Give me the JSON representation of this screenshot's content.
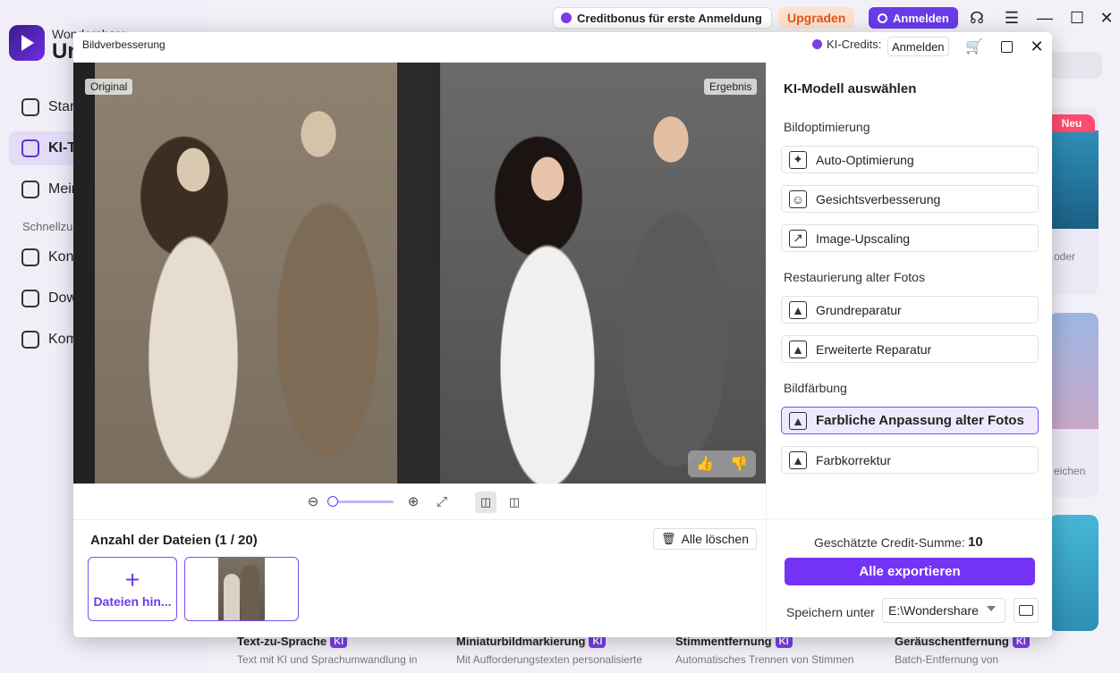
{
  "app": {
    "brand_top": "Wondershare",
    "brand_main": "Uni",
    "sidebar": {
      "items": [
        {
          "label": "Start"
        },
        {
          "label": "KI-Tools"
        },
        {
          "label": "Meine Dateien"
        }
      ],
      "section": "Schnellzugriff",
      "quick": [
        {
          "label": "Konvertieren"
        },
        {
          "label": "Download"
        },
        {
          "label": "Komprimieren"
        }
      ]
    },
    "topbar": {
      "credit_bonus": "Creditbonus für erste Anmeldung",
      "upgrade": "Upgraden",
      "signin": "Anmelden"
    },
    "background_right": {
      "neu_badge": "Neu",
      "fragment_1": "oder",
      "fragment_2": "eichen"
    },
    "bottom_tools": [
      {
        "title": "Text-zu-Sprache",
        "desc": "Text mit KI und Sprachumwandlung in"
      },
      {
        "title": "Miniaturbildmarkierung",
        "desc": "Mit Aufforderungstexten personalisierte"
      },
      {
        "title": "Stimmentfernung",
        "desc": "Automatisches Trennen von Stimmen"
      },
      {
        "title": "Geräuschentfernung",
        "desc": "Batch-Entfernung von"
      }
    ],
    "ki_tag": "KI"
  },
  "modal": {
    "title": "Bildverbesserung",
    "credits_label": "KI-Credits:",
    "signin": "Anmelden",
    "preview": {
      "original_tag": "Original",
      "result_tag": "Ergebnis"
    },
    "files": {
      "count_label": "Anzahl der Dateien (1 / 20)",
      "clear_all": "Alle löschen",
      "add_files": "Dateien hin..."
    },
    "panel": {
      "title": "KI-Modell auswählen",
      "section_optimize": "Bildoptimierung",
      "section_restore": "Restaurierung alter Fotos",
      "section_color": "Bildfärbung",
      "btn_auto": "Auto-Optimierung",
      "btn_face": "Gesichtsverbesserung",
      "btn_upscale": "Image-Upscaling",
      "btn_basic_repair": "Grundreparatur",
      "btn_adv_repair": "Erweiterte Reparatur",
      "btn_colorize": "Farbliche Anpassung alter Fotos",
      "btn_color_correct": "Farbkorrektur",
      "credit_sum_label": "Geschätzte Credit-Summe:",
      "credit_sum_value": "10",
      "export_all": "Alle exportieren",
      "save_label": "Speichern unter",
      "save_path": "E:\\Wondershare"
    }
  }
}
